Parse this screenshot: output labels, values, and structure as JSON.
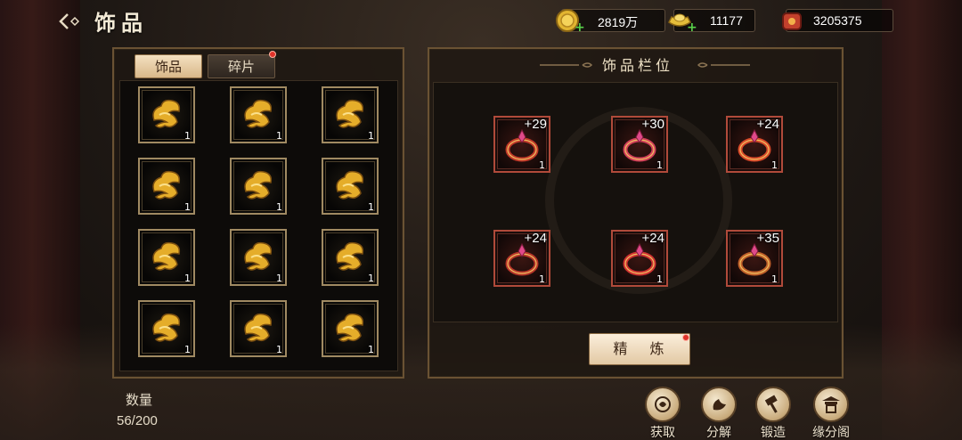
{
  "header": {
    "title": "饰品"
  },
  "resources": [
    {
      "icon": "gold-coin-icon",
      "value": "2819万"
    },
    {
      "icon": "gold-ingot-icon",
      "value": "11177"
    },
    {
      "icon": "red-gem-pouch-icon",
      "value": "3205375"
    }
  ],
  "tabs": [
    {
      "label": "饰品",
      "active": true
    },
    {
      "label": "碎片",
      "active": false,
      "notification": true
    }
  ],
  "inventory": {
    "items": [
      {
        "icon": "gold-cloud-ornament-icon",
        "count": "1"
      },
      {
        "icon": "gold-cloud-ornament-icon",
        "count": "1"
      },
      {
        "icon": "gold-cloud-ornament-icon",
        "count": "1"
      },
      {
        "icon": "gold-cloud-ornament-icon",
        "count": "1"
      },
      {
        "icon": "gold-cloud-ornament-icon",
        "count": "1"
      },
      {
        "icon": "gold-cloud-ornament-icon",
        "count": "1"
      },
      {
        "icon": "gold-cloud-ornament-icon",
        "count": "1"
      },
      {
        "icon": "gold-cloud-ornament-icon",
        "count": "1"
      },
      {
        "icon": "gold-cloud-ornament-icon",
        "count": "1"
      },
      {
        "icon": "gold-cloud-ornament-icon",
        "count": "1"
      },
      {
        "icon": "gold-cloud-ornament-icon",
        "count": "1"
      },
      {
        "icon": "gold-cloud-ornament-icon",
        "count": "1"
      }
    ],
    "quantity_label": "数量",
    "quantity_value": "56/200"
  },
  "slots_section": {
    "title": "饰品栏位",
    "slots": [
      {
        "icon": "red-ribbon-ornament-icon",
        "level": "+29",
        "count": "1"
      },
      {
        "icon": "red-crystal-ornament-icon",
        "level": "+30",
        "count": "1"
      },
      {
        "icon": "gold-red-ring-icon",
        "level": "+24",
        "count": "1"
      },
      {
        "icon": "red-knot-ornament-icon",
        "level": "+24",
        "count": "1"
      },
      {
        "icon": "red-gem-ring-icon",
        "level": "+24",
        "count": "1"
      },
      {
        "icon": "gold-purple-ring-icon",
        "level": "+35",
        "count": "1"
      }
    ],
    "refine_label": "精 炼"
  },
  "actions": [
    {
      "icon": "obtain-icon",
      "label": "获取"
    },
    {
      "icon": "decompose-icon",
      "label": "分解"
    },
    {
      "icon": "forge-hammer-icon",
      "label": "锻造"
    },
    {
      "icon": "pavilion-icon",
      "label": "缘分阁"
    }
  ],
  "colors": {
    "panel_border": "#6a5233",
    "slot_border": "#a08a62",
    "equip_border": "#b04a3a",
    "notification": "#e0322a",
    "plus": "#59d14a"
  }
}
